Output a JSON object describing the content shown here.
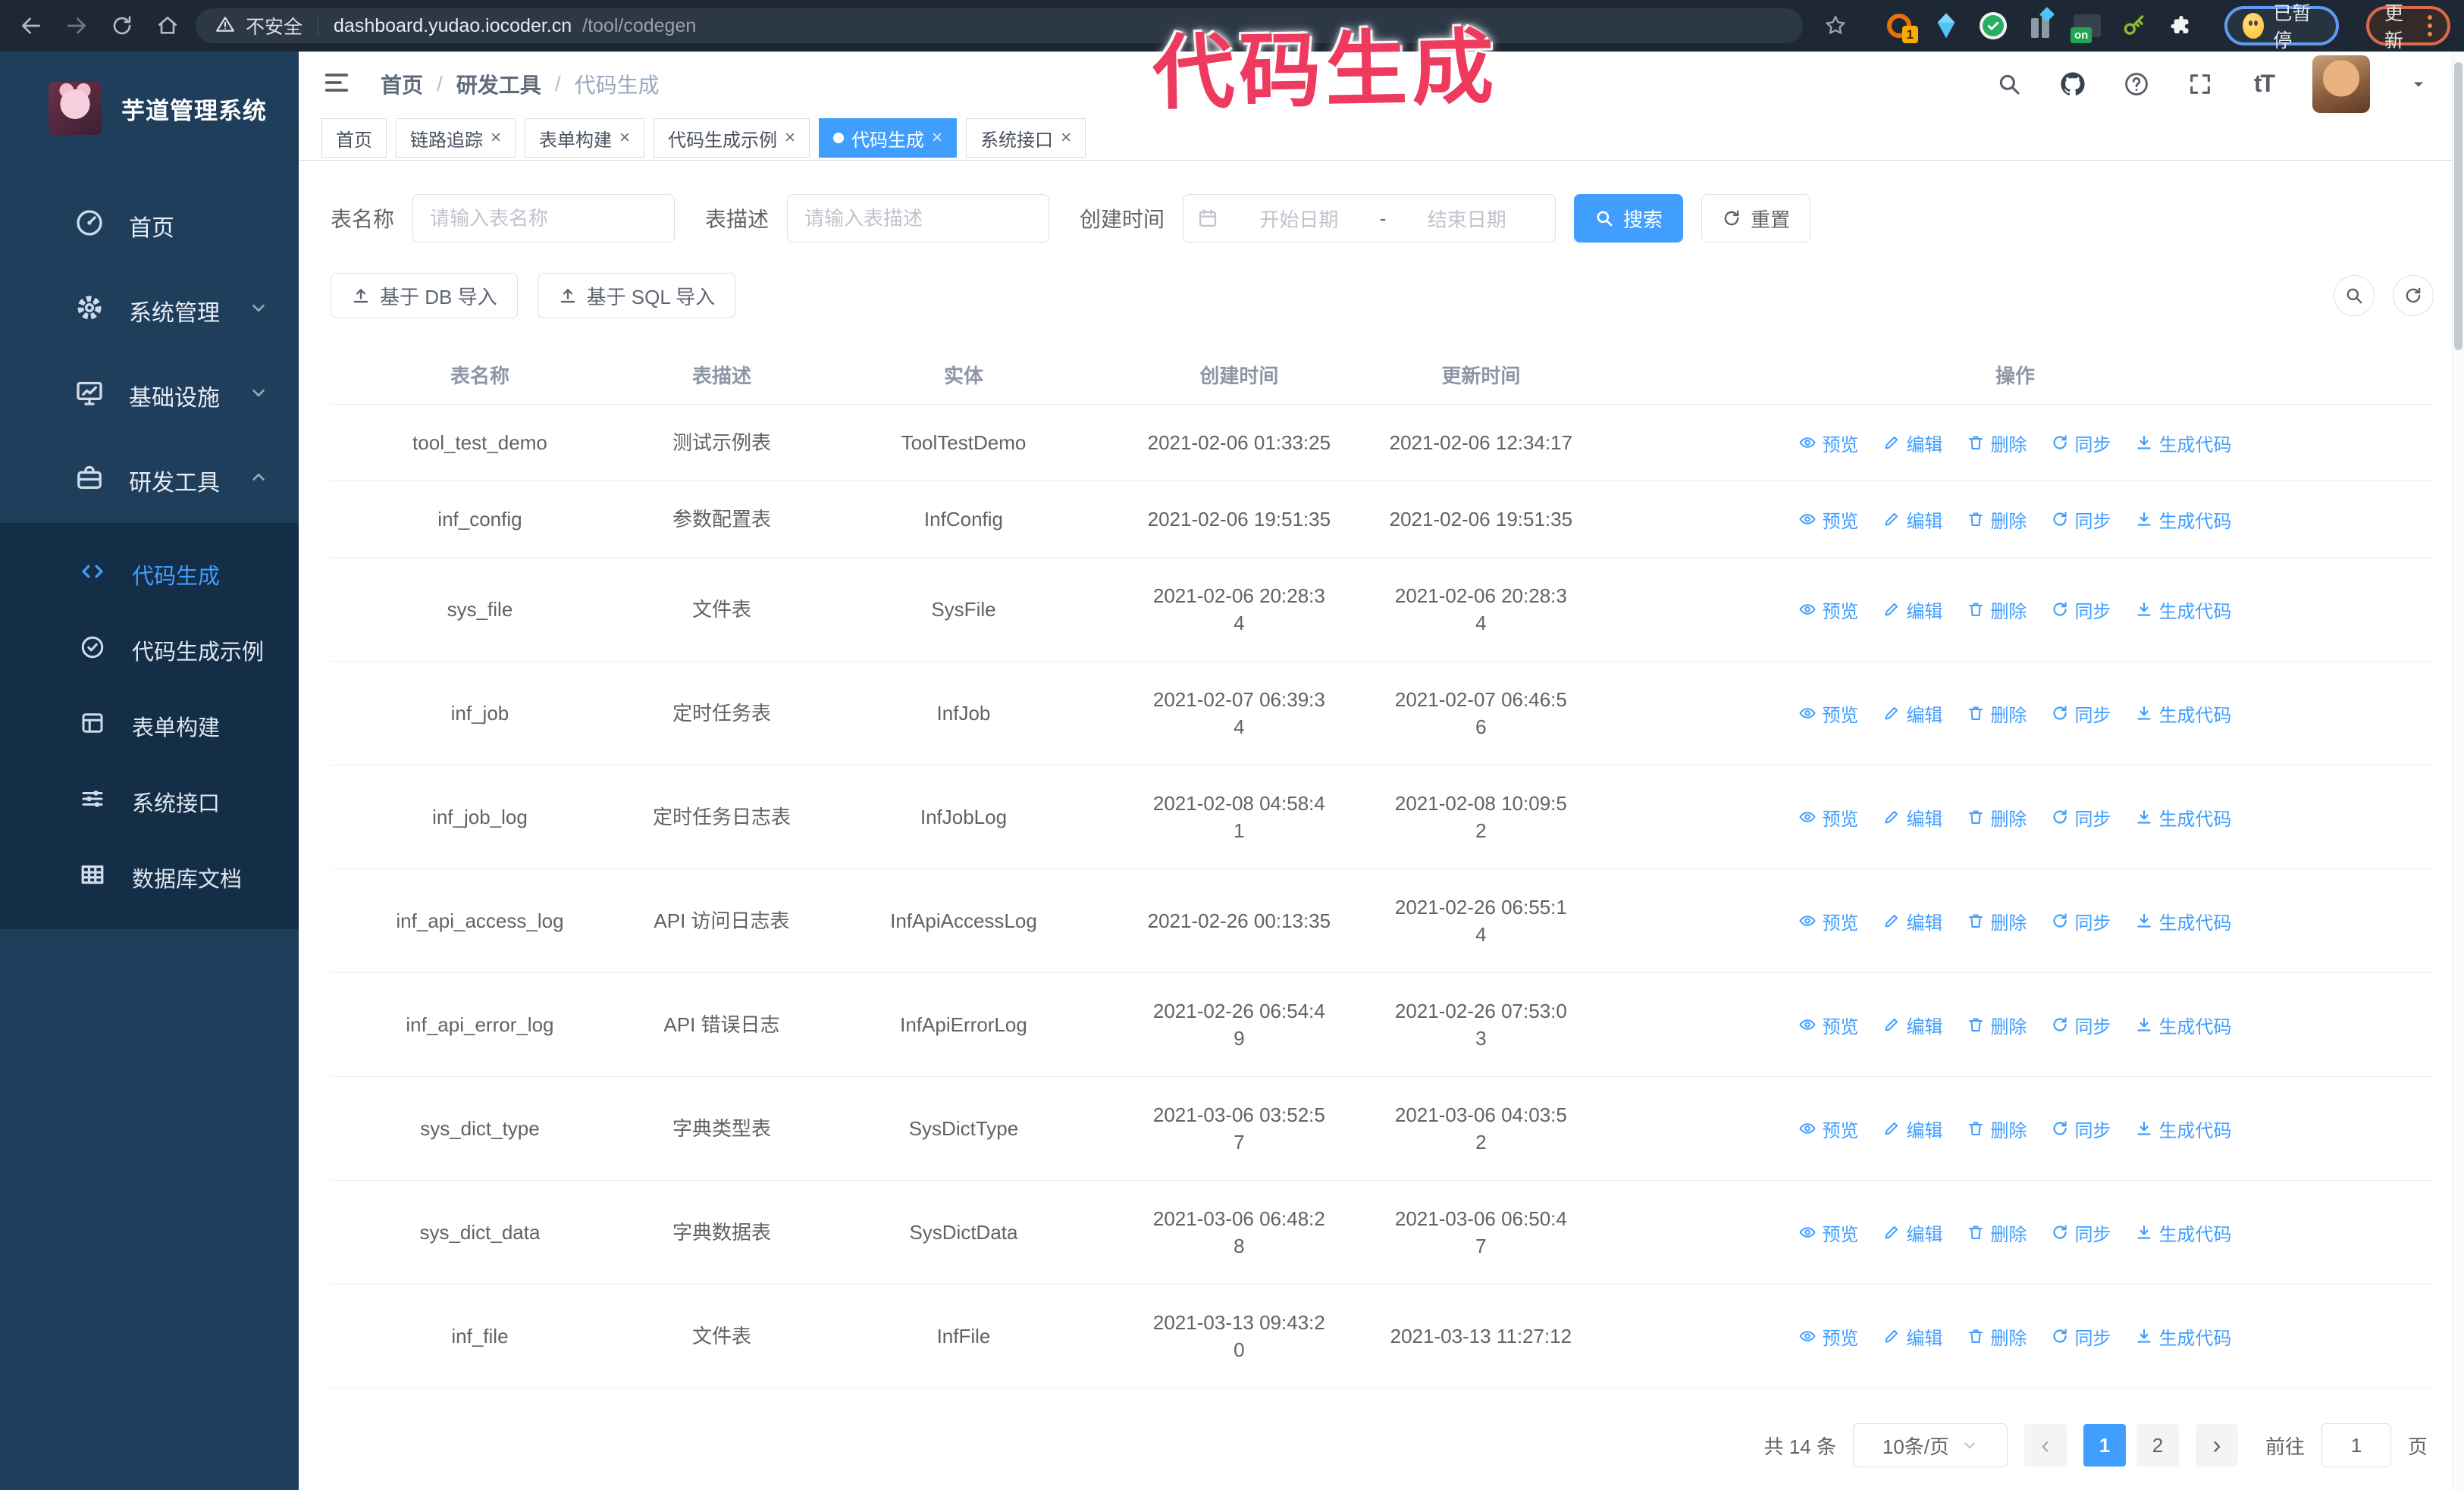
{
  "browser": {
    "security_label": "不安全",
    "url_host": "dashboard.yudao.iocoder.cn",
    "url_path": "/tool/codegen",
    "ext_badge_count": "1",
    "ext_on_label": "on",
    "paused_label": "已暂停",
    "update_label": "更新"
  },
  "annotation": {
    "text": "代码生成",
    "color": "#ee3a5f"
  },
  "sidebar": {
    "title": "芋道管理系统",
    "menu": [
      {
        "label": "首页",
        "icon": "dashboard",
        "chevron": "",
        "active": false
      },
      {
        "label": "系统管理",
        "icon": "gear",
        "chevron": "down",
        "active": false
      },
      {
        "label": "基础设施",
        "icon": "monitor",
        "chevron": "down",
        "active": false
      },
      {
        "label": "研发工具",
        "icon": "toolbox",
        "chevron": "up",
        "active": false
      }
    ],
    "submenu": [
      {
        "label": "代码生成",
        "icon": "code",
        "active": true
      },
      {
        "label": "代码生成示例",
        "icon": "badge-check",
        "active": false
      },
      {
        "label": "表单构建",
        "icon": "form",
        "active": false
      },
      {
        "label": "系统接口",
        "icon": "sliders",
        "active": false
      },
      {
        "label": "数据库文档",
        "icon": "grid",
        "active": false
      }
    ]
  },
  "header": {
    "breadcrumb": [
      "首页",
      "研发工具",
      "代码生成"
    ],
    "separator": "/"
  },
  "tabs": {
    "close_glyph": "×",
    "items": [
      {
        "label": "首页",
        "closable": false,
        "active": false
      },
      {
        "label": "链路追踪",
        "closable": true,
        "active": false
      },
      {
        "label": "表单构建",
        "closable": true,
        "active": false
      },
      {
        "label": "代码生成示例",
        "closable": true,
        "active": false
      },
      {
        "label": "代码生成",
        "closable": true,
        "active": true
      },
      {
        "label": "系统接口",
        "closable": true,
        "active": false
      }
    ]
  },
  "search": {
    "table_name_label": "表名称",
    "table_name_placeholder": "请输入表名称",
    "table_desc_label": "表描述",
    "table_desc_placeholder": "请输入表描述",
    "create_time_label": "创建时间",
    "date_start_placeholder": "开始日期",
    "date_separator": "-",
    "date_end_placeholder": "结束日期",
    "search_button": "搜索",
    "reset_button": "重置"
  },
  "toolbar": {
    "import_db_button": "基于 DB 导入",
    "import_sql_button": "基于 SQL 导入"
  },
  "table": {
    "columns": [
      "表名称",
      "表描述",
      "实体",
      "创建时间",
      "更新时间",
      "操作"
    ],
    "actions": [
      "预览",
      "编辑",
      "删除",
      "同步",
      "生成代码"
    ],
    "rows": [
      {
        "name": "tool_test_demo",
        "desc": "测试示例表",
        "entity": "ToolTestDemo",
        "created": "2021-02-06 01:33:25",
        "updated": "2021-02-06 12:34:17"
      },
      {
        "name": "inf_config",
        "desc": "参数配置表",
        "entity": "InfConfig",
        "created": "2021-02-06 19:51:35",
        "updated": "2021-02-06 19:51:35"
      },
      {
        "name": "sys_file",
        "desc": "文件表",
        "entity": "SysFile",
        "created": "2021-02-06 20:28:3\n4",
        "updated": "2021-02-06 20:28:3\n4"
      },
      {
        "name": "inf_job",
        "desc": "定时任务表",
        "entity": "InfJob",
        "created": "2021-02-07 06:39:3\n4",
        "updated": "2021-02-07 06:46:5\n6"
      },
      {
        "name": "inf_job_log",
        "desc": "定时任务日志表",
        "entity": "InfJobLog",
        "created": "2021-02-08 04:58:4\n1",
        "updated": "2021-02-08 10:09:5\n2"
      },
      {
        "name": "inf_api_access_log",
        "desc": "API 访问日志表",
        "entity": "InfApiAccessLog",
        "created": "2021-02-26 00:13:35",
        "updated": "2021-02-26 06:55:1\n4"
      },
      {
        "name": "inf_api_error_log",
        "desc": "API 错误日志",
        "entity": "InfApiErrorLog",
        "created": "2021-02-26 06:54:4\n9",
        "updated": "2021-02-26 07:53:0\n3"
      },
      {
        "name": "sys_dict_type",
        "desc": "字典类型表",
        "entity": "SysDictType",
        "created": "2021-03-06 03:52:5\n7",
        "updated": "2021-03-06 04:03:5\n2"
      },
      {
        "name": "sys_dict_data",
        "desc": "字典数据表",
        "entity": "SysDictData",
        "created": "2021-03-06 06:48:2\n8",
        "updated": "2021-03-06 06:50:4\n7"
      },
      {
        "name": "inf_file",
        "desc": "文件表",
        "entity": "InfFile",
        "created": "2021-03-13 09:43:2\n0",
        "updated": "2021-03-13 11:27:12"
      }
    ]
  },
  "pagination": {
    "total_label": "共 14 条",
    "page_size_label": "10条/页",
    "prev_glyph": "‹",
    "next_glyph": "›",
    "pages": [
      {
        "label": "1",
        "active": true
      },
      {
        "label": "2",
        "active": false
      }
    ],
    "goto_label": "前往",
    "goto_value": "1",
    "page_suffix": "页"
  }
}
